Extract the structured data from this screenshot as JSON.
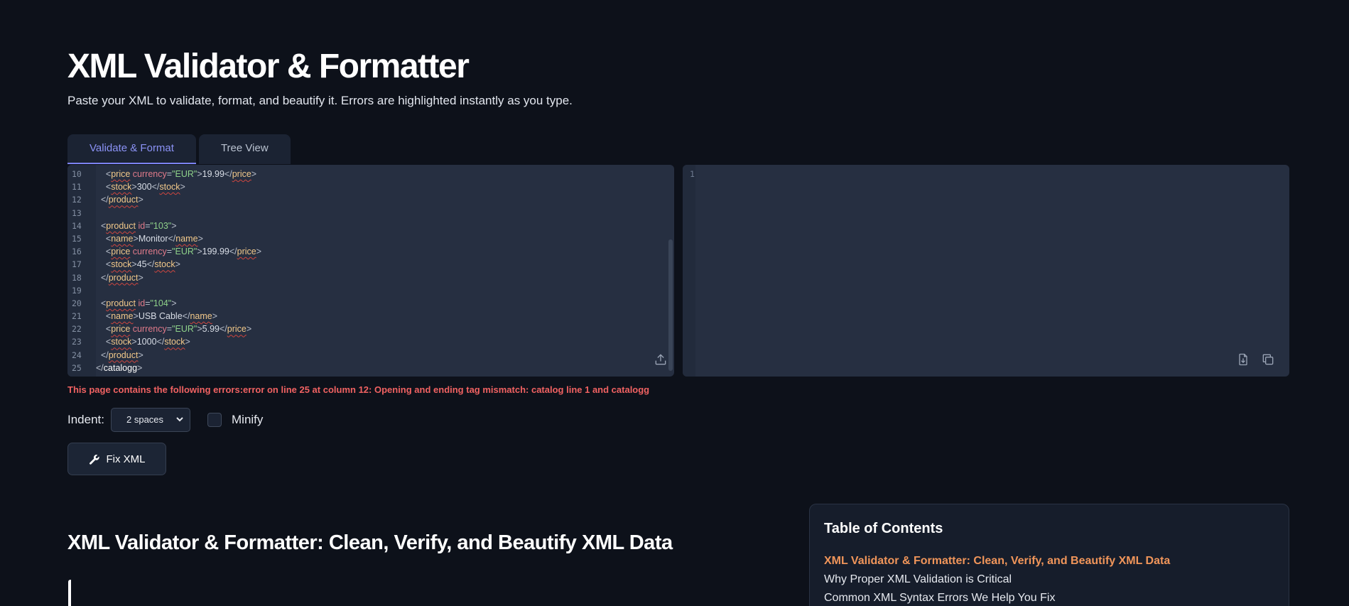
{
  "header": {
    "title": "XML Validator & Formatter",
    "subtitle": "Paste your XML to validate, format, and beautify it. Errors are highlighted instantly as you type."
  },
  "tabs": [
    {
      "label": "Validate & Format",
      "active": true
    },
    {
      "label": "Tree View",
      "active": false
    }
  ],
  "input_editor": {
    "lines": [
      {
        "n": "10",
        "indent": "    ",
        "tag": "price",
        "attr": "currency",
        "val": "\"EUR\"",
        "text": "19.99",
        "close": "price"
      },
      {
        "n": "11",
        "indent": "    ",
        "tag": "stock",
        "text": "300",
        "close": "stock"
      },
      {
        "n": "12",
        "indent": "  ",
        "closeonly": "product"
      },
      {
        "n": "13"
      },
      {
        "n": "14",
        "indent": "  ",
        "tag": "product",
        "attr": "id",
        "val": "\"103\""
      },
      {
        "n": "15",
        "indent": "    ",
        "tag": "name",
        "text": "Monitor",
        "close": "name"
      },
      {
        "n": "16",
        "indent": "    ",
        "tag": "price",
        "attr": "currency",
        "val": "\"EUR\"",
        "text": "199.99",
        "close": "price"
      },
      {
        "n": "17",
        "indent": "    ",
        "tag": "stock",
        "text": "45",
        "close": "stock"
      },
      {
        "n": "18",
        "indent": "  ",
        "closeonly": "product"
      },
      {
        "n": "19"
      },
      {
        "n": "20",
        "indent": "  ",
        "tag": "product",
        "attr": "id",
        "val": "\"104\""
      },
      {
        "n": "21",
        "indent": "    ",
        "tag": "name",
        "text": "USB Cable",
        "close": "name"
      },
      {
        "n": "22",
        "indent": "    ",
        "tag": "price",
        "attr": "currency",
        "val": "\"EUR\"",
        "text": "5.99",
        "close": "price"
      },
      {
        "n": "23",
        "indent": "    ",
        "tag": "stock",
        "text": "1000",
        "close": "stock"
      },
      {
        "n": "24",
        "indent": "  ",
        "closeonly": "product"
      },
      {
        "n": "25",
        "indent": "",
        "closeplain": "catalogg"
      }
    ],
    "upload_icon": "upload-icon"
  },
  "output_editor": {
    "line_number": "1",
    "download_icon": "download-file-icon",
    "copy_icon": "copy-icon"
  },
  "error_message": "This page contains the following errors:error on line 25 at column 12: Opening and ending tag mismatch: catalog line 1 and catalogg",
  "options": {
    "indent_label": "Indent:",
    "indent_value": "2 spaces",
    "minify_label": "Minify",
    "minify_checked": false
  },
  "fix_button": {
    "label": "Fix XML",
    "icon": "wrench-icon"
  },
  "article": {
    "heading": "XML Validator & Formatter: Clean, Verify, and Beautify XML Data"
  },
  "toc": {
    "title": "Table of Contents",
    "items": [
      {
        "label": "XML Validator & Formatter: Clean, Verify, and Beautify XML Data",
        "active": true
      },
      {
        "label": "Why Proper XML Validation is Critical",
        "active": false
      },
      {
        "label": "Common XML Syntax Errors We Help You Fix",
        "active": false
      }
    ]
  },
  "colors": {
    "accent": "#7c83f2",
    "error": "#f06262",
    "toc_active": "#f0955a",
    "background": "#0d111a"
  }
}
